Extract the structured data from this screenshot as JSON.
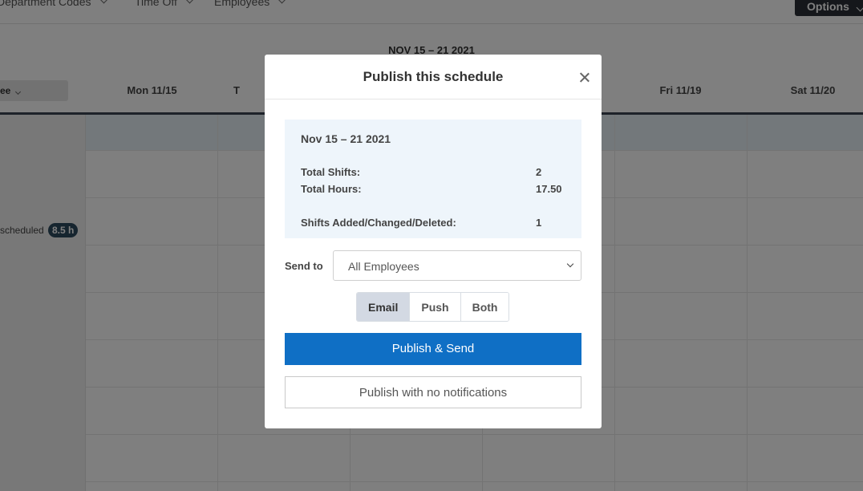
{
  "toolbar": {
    "department_codes": "Department Codes",
    "time_off": "Time Off",
    "employees": "Employees",
    "options": "Options"
  },
  "schedule": {
    "range": "NOV 15 – 21 2021",
    "employee_select": "ee",
    "days": [
      "Mon 11/15",
      "T",
      "",
      "",
      "Fri 11/19",
      "Sat 11/20"
    ],
    "scheduled_label": "scheduled",
    "hours_badge": "8.5 h"
  },
  "modal": {
    "title": "Publish this schedule",
    "summary": {
      "range": "Nov 15 – 21 2021",
      "total_shifts_label": "Total Shifts:",
      "total_shifts_value": "2",
      "total_hours_label": "Total Hours:",
      "total_hours_value": "17.50",
      "changes_label": "Shifts Added/Changed/Deleted:",
      "changes_value": "1"
    },
    "send_to_label": "Send to",
    "send_to_value": "All Employees",
    "notify_options": [
      "Email",
      "Push",
      "Both"
    ],
    "notify_selected": "Email",
    "publish_send_label": "Publish & Send",
    "publish_no_notify_label": "Publish with no notifications"
  }
}
